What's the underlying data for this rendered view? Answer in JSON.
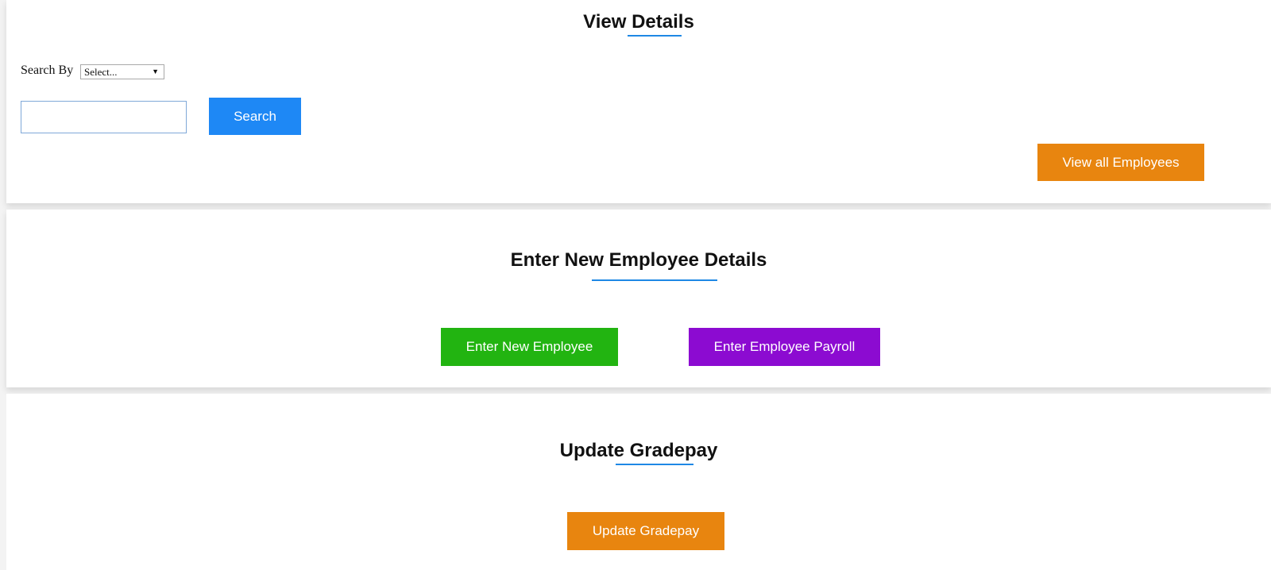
{
  "view_details": {
    "title": "View Details",
    "search_by_label": "Search By",
    "search_select_value": "Select...",
    "search_input_value": "",
    "search_button": "Search",
    "view_all_button": "View all Employees"
  },
  "new_employee": {
    "title": "Enter New Employee Details",
    "new_employee_button": "Enter New Employee",
    "payroll_button": "Enter Employee Payroll"
  },
  "gradepay": {
    "title": "Update Gradepay",
    "update_button": "Update Gradepay"
  },
  "colors": {
    "accent_blue": "#1e88f5",
    "orange": "#e8850f",
    "green": "#22b411",
    "purple": "#8c0bd1"
  }
}
